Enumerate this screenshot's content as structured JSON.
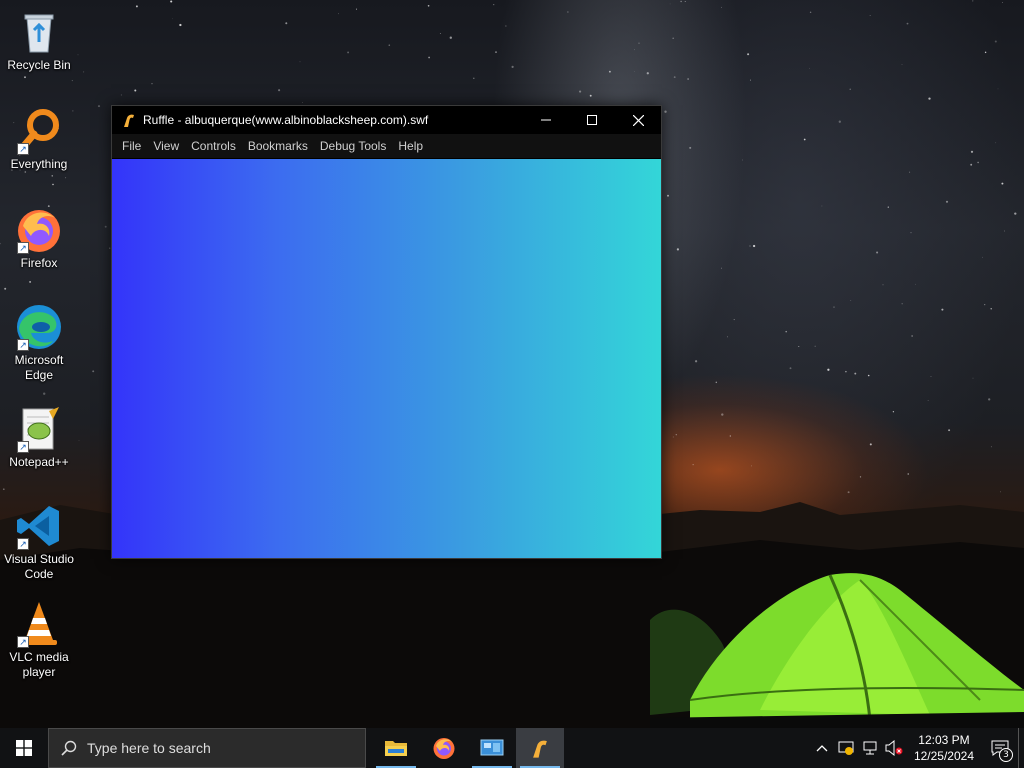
{
  "desktop": {
    "icons": [
      {
        "label": "Recycle Bin",
        "icon": "recycle-bin-icon"
      },
      {
        "label": "Everything",
        "icon": "everything-search-icon"
      },
      {
        "label": "Firefox",
        "icon": "firefox-icon"
      },
      {
        "label": "Microsoft Edge",
        "icon": "edge-icon"
      },
      {
        "label": "Notepad++",
        "icon": "notepadpp-icon"
      },
      {
        "label": "Visual Studio Code",
        "icon": "vscode-icon"
      },
      {
        "label": "VLC media player",
        "icon": "vlc-icon"
      }
    ]
  },
  "window": {
    "title": "Ruffle - albuquerque(www.albinoblacksheep.com).swf",
    "app_icon": "ruffle-icon",
    "controls": {
      "minimize": "minimize-icon",
      "maximize": "maximize-icon",
      "close": "close-icon"
    },
    "menu": [
      "File",
      "View",
      "Controls",
      "Bookmarks",
      "Debug Tools",
      "Help"
    ],
    "content_colors": {
      "left": "#3434fa",
      "right": "#33d6d8"
    }
  },
  "taskbar": {
    "search_placeholder": "Type here to search",
    "apps": [
      {
        "name": "File Explorer",
        "icon": "file-explorer-icon",
        "running": true
      },
      {
        "name": "Firefox",
        "icon": "firefox-icon",
        "running": false
      },
      {
        "name": "Control Panel",
        "icon": "control-panel-icon",
        "running": true
      },
      {
        "name": "Ruffle",
        "icon": "ruffle-icon",
        "running": true,
        "active": true
      }
    ],
    "clock": {
      "time": "12:03 PM",
      "date": "12/25/2024"
    },
    "notification_count": "3",
    "accent": "#76b9ed"
  }
}
